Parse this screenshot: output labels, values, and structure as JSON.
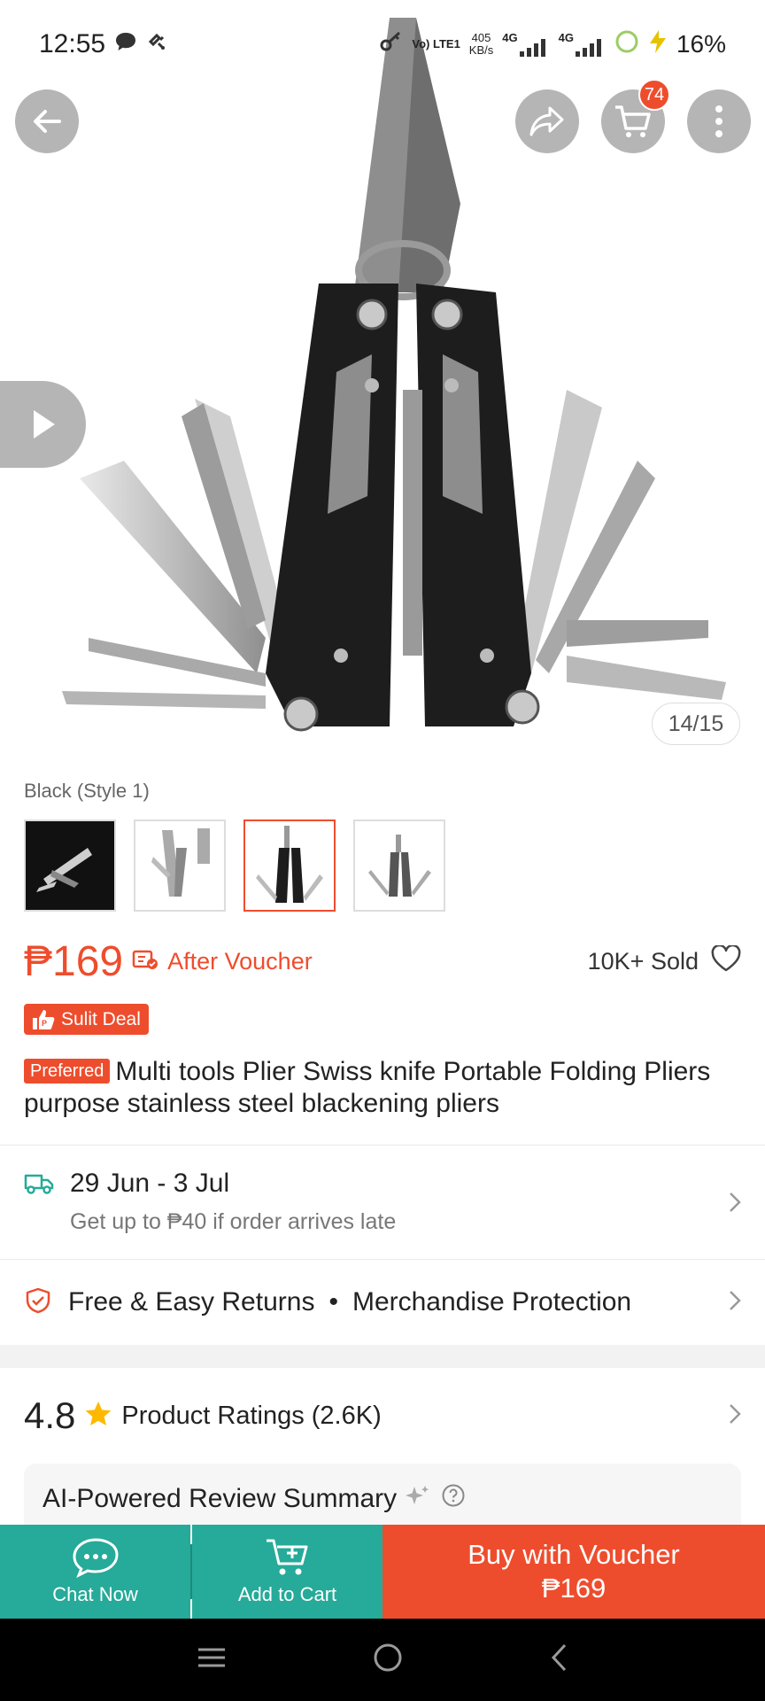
{
  "status_bar": {
    "time": "12:55",
    "volte": "Vo) LTE1",
    "speed_value": "405",
    "speed_unit": "KB/s",
    "net1": "4G",
    "net2": "4G",
    "battery": "16%"
  },
  "top_actions": {
    "cart_count": "74"
  },
  "gallery": {
    "counter": "14/15"
  },
  "variation": {
    "selected_label": "Black (Style 1)",
    "thumbnails": [
      "Style 1 black",
      "Style 2 silver",
      "Style 3 black",
      "Style 4 grey"
    ]
  },
  "price": {
    "amount": "₱169",
    "after_voucher": "After Voucher",
    "sold": "10K+ Sold"
  },
  "badge": {
    "sulit": "Sulit Deal",
    "preferred": "Preferred"
  },
  "product": {
    "title": "Multi tools Plier Swiss knife Portable Folding Pliers purpose stainless steel blackening pliers"
  },
  "shipping": {
    "dates": "29 Jun - 3 Jul",
    "guarantee": "Get up to ₱40 if order arrives late"
  },
  "returns": {
    "item1": "Free & Easy Returns",
    "separator": "•",
    "item2": "Merchandise Protection"
  },
  "ratings": {
    "score": "4.8",
    "label": "Product Ratings (2.6K)"
  },
  "ai_summary": {
    "title": "AI-Powered Review Summary"
  },
  "bottom_bar": {
    "chat": "Chat Now",
    "add_to_cart": "Add to Cart",
    "buy_label": "Buy with Voucher",
    "buy_price": "₱169"
  },
  "colors": {
    "brand": "#ee4d2d",
    "teal": "#26aa99"
  }
}
